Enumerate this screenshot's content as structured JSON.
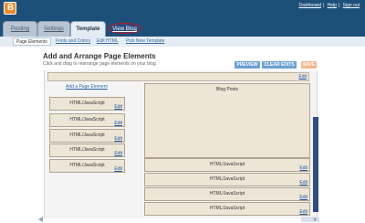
{
  "header": {
    "links": [
      "Dashboard",
      "Help",
      "Sign out"
    ]
  },
  "tabs": [
    {
      "label": "Posting"
    },
    {
      "label": "Settings"
    },
    {
      "label": "Template"
    },
    {
      "label": "View Blog"
    }
  ],
  "subtabs": [
    {
      "label": "Page Elements"
    },
    {
      "label": "Fonts and Colors"
    },
    {
      "label": "Edit HTML"
    },
    {
      "label": "Pick New Template"
    }
  ],
  "page": {
    "title": "Add and Arrange Page Elements",
    "subtitle": "Click and drag to rearrange page elements on your blog."
  },
  "buttons": {
    "preview": "PREVIEW",
    "clear_edits": "CLEAR EDITS",
    "save": "SAVE"
  },
  "layout": {
    "edit_label": "Edit",
    "add_element": "Add a Page Element",
    "blog_posts": "Blog Posts",
    "widget_label": "HTML/JavaScript"
  },
  "colors": {
    "topbar": "#1d5079",
    "widget_bg": "#ede5d6",
    "link": "#1b5aa6",
    "highlight_circle": "#c01818"
  }
}
